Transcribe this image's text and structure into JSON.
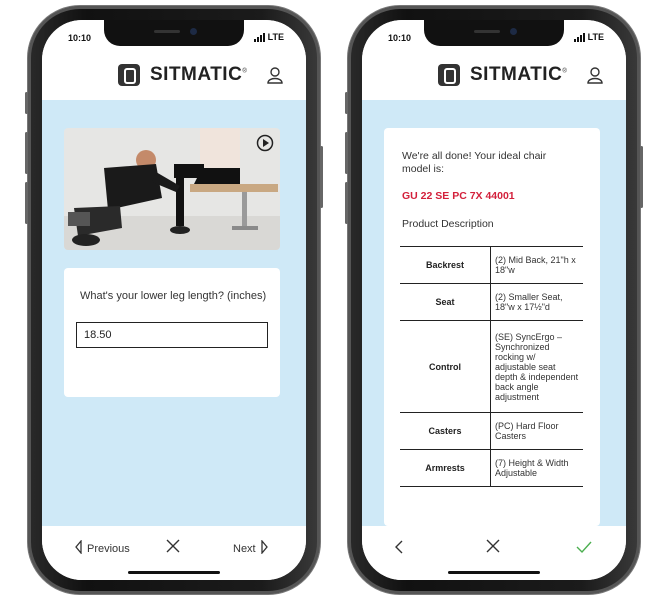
{
  "status": {
    "time": "10:10",
    "network": "LTE"
  },
  "brand": {
    "name": "SITMATIC",
    "registered": "®"
  },
  "left_screen": {
    "question": "What's your lower leg length? (inches)",
    "answer": "18.50",
    "nav": {
      "previous": "Previous",
      "next": "Next"
    }
  },
  "right_screen": {
    "intro": "We're all done! Your ideal chair model is:",
    "model_code": "GU 22 SE PC 7X 44001",
    "description_heading": "Product Description",
    "spec_rows": [
      {
        "label": "Backrest",
        "value": "(2) Mid Back, 21\"h x 18\"w"
      },
      {
        "label": "Seat",
        "value": "(2) Smaller Seat, 18\"w x 17½\"d"
      },
      {
        "label": "Control",
        "value": "(SE) SyncErgo – Synchronized rocking w/ adjustable seat depth & independent back angle adjustment"
      },
      {
        "label": "Casters",
        "value": "(PC) Hard Floor Casters"
      },
      {
        "label": "Armrests",
        "value": "(7) Height & Width Adjustable"
      }
    ]
  },
  "colors": {
    "background": "#cfe9f7",
    "accent_red": "#d3203b",
    "check_green": "#4caf50"
  },
  "icons": [
    "user-icon",
    "play-icon",
    "chevron-left-icon",
    "close-icon",
    "chevron-right-icon",
    "check-icon",
    "signal-icon"
  ]
}
